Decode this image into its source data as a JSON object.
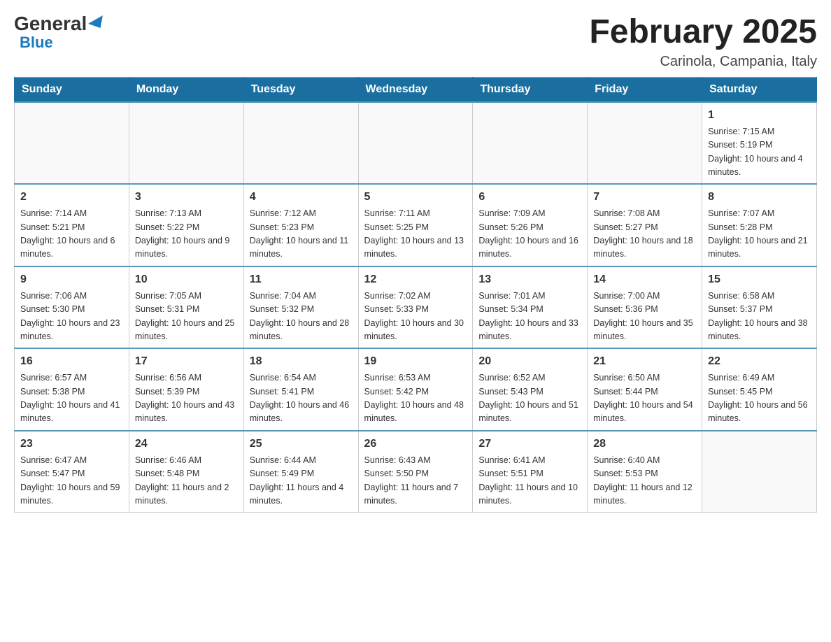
{
  "header": {
    "logo_general": "General",
    "logo_blue": "Blue",
    "month_title": "February 2025",
    "location": "Carinola, Campania, Italy"
  },
  "days_of_week": [
    "Sunday",
    "Monday",
    "Tuesday",
    "Wednesday",
    "Thursday",
    "Friday",
    "Saturday"
  ],
  "weeks": [
    [
      {
        "day": "",
        "info": ""
      },
      {
        "day": "",
        "info": ""
      },
      {
        "day": "",
        "info": ""
      },
      {
        "day": "",
        "info": ""
      },
      {
        "day": "",
        "info": ""
      },
      {
        "day": "",
        "info": ""
      },
      {
        "day": "1",
        "info": "Sunrise: 7:15 AM\nSunset: 5:19 PM\nDaylight: 10 hours and 4 minutes."
      }
    ],
    [
      {
        "day": "2",
        "info": "Sunrise: 7:14 AM\nSunset: 5:21 PM\nDaylight: 10 hours and 6 minutes."
      },
      {
        "day": "3",
        "info": "Sunrise: 7:13 AM\nSunset: 5:22 PM\nDaylight: 10 hours and 9 minutes."
      },
      {
        "day": "4",
        "info": "Sunrise: 7:12 AM\nSunset: 5:23 PM\nDaylight: 10 hours and 11 minutes."
      },
      {
        "day": "5",
        "info": "Sunrise: 7:11 AM\nSunset: 5:25 PM\nDaylight: 10 hours and 13 minutes."
      },
      {
        "day": "6",
        "info": "Sunrise: 7:09 AM\nSunset: 5:26 PM\nDaylight: 10 hours and 16 minutes."
      },
      {
        "day": "7",
        "info": "Sunrise: 7:08 AM\nSunset: 5:27 PM\nDaylight: 10 hours and 18 minutes."
      },
      {
        "day": "8",
        "info": "Sunrise: 7:07 AM\nSunset: 5:28 PM\nDaylight: 10 hours and 21 minutes."
      }
    ],
    [
      {
        "day": "9",
        "info": "Sunrise: 7:06 AM\nSunset: 5:30 PM\nDaylight: 10 hours and 23 minutes."
      },
      {
        "day": "10",
        "info": "Sunrise: 7:05 AM\nSunset: 5:31 PM\nDaylight: 10 hours and 25 minutes."
      },
      {
        "day": "11",
        "info": "Sunrise: 7:04 AM\nSunset: 5:32 PM\nDaylight: 10 hours and 28 minutes."
      },
      {
        "day": "12",
        "info": "Sunrise: 7:02 AM\nSunset: 5:33 PM\nDaylight: 10 hours and 30 minutes."
      },
      {
        "day": "13",
        "info": "Sunrise: 7:01 AM\nSunset: 5:34 PM\nDaylight: 10 hours and 33 minutes."
      },
      {
        "day": "14",
        "info": "Sunrise: 7:00 AM\nSunset: 5:36 PM\nDaylight: 10 hours and 35 minutes."
      },
      {
        "day": "15",
        "info": "Sunrise: 6:58 AM\nSunset: 5:37 PM\nDaylight: 10 hours and 38 minutes."
      }
    ],
    [
      {
        "day": "16",
        "info": "Sunrise: 6:57 AM\nSunset: 5:38 PM\nDaylight: 10 hours and 41 minutes."
      },
      {
        "day": "17",
        "info": "Sunrise: 6:56 AM\nSunset: 5:39 PM\nDaylight: 10 hours and 43 minutes."
      },
      {
        "day": "18",
        "info": "Sunrise: 6:54 AM\nSunset: 5:41 PM\nDaylight: 10 hours and 46 minutes."
      },
      {
        "day": "19",
        "info": "Sunrise: 6:53 AM\nSunset: 5:42 PM\nDaylight: 10 hours and 48 minutes."
      },
      {
        "day": "20",
        "info": "Sunrise: 6:52 AM\nSunset: 5:43 PM\nDaylight: 10 hours and 51 minutes."
      },
      {
        "day": "21",
        "info": "Sunrise: 6:50 AM\nSunset: 5:44 PM\nDaylight: 10 hours and 54 minutes."
      },
      {
        "day": "22",
        "info": "Sunrise: 6:49 AM\nSunset: 5:45 PM\nDaylight: 10 hours and 56 minutes."
      }
    ],
    [
      {
        "day": "23",
        "info": "Sunrise: 6:47 AM\nSunset: 5:47 PM\nDaylight: 10 hours and 59 minutes."
      },
      {
        "day": "24",
        "info": "Sunrise: 6:46 AM\nSunset: 5:48 PM\nDaylight: 11 hours and 2 minutes."
      },
      {
        "day": "25",
        "info": "Sunrise: 6:44 AM\nSunset: 5:49 PM\nDaylight: 11 hours and 4 minutes."
      },
      {
        "day": "26",
        "info": "Sunrise: 6:43 AM\nSunset: 5:50 PM\nDaylight: 11 hours and 7 minutes."
      },
      {
        "day": "27",
        "info": "Sunrise: 6:41 AM\nSunset: 5:51 PM\nDaylight: 11 hours and 10 minutes."
      },
      {
        "day": "28",
        "info": "Sunrise: 6:40 AM\nSunset: 5:53 PM\nDaylight: 11 hours and 12 minutes."
      },
      {
        "day": "",
        "info": ""
      }
    ]
  ]
}
